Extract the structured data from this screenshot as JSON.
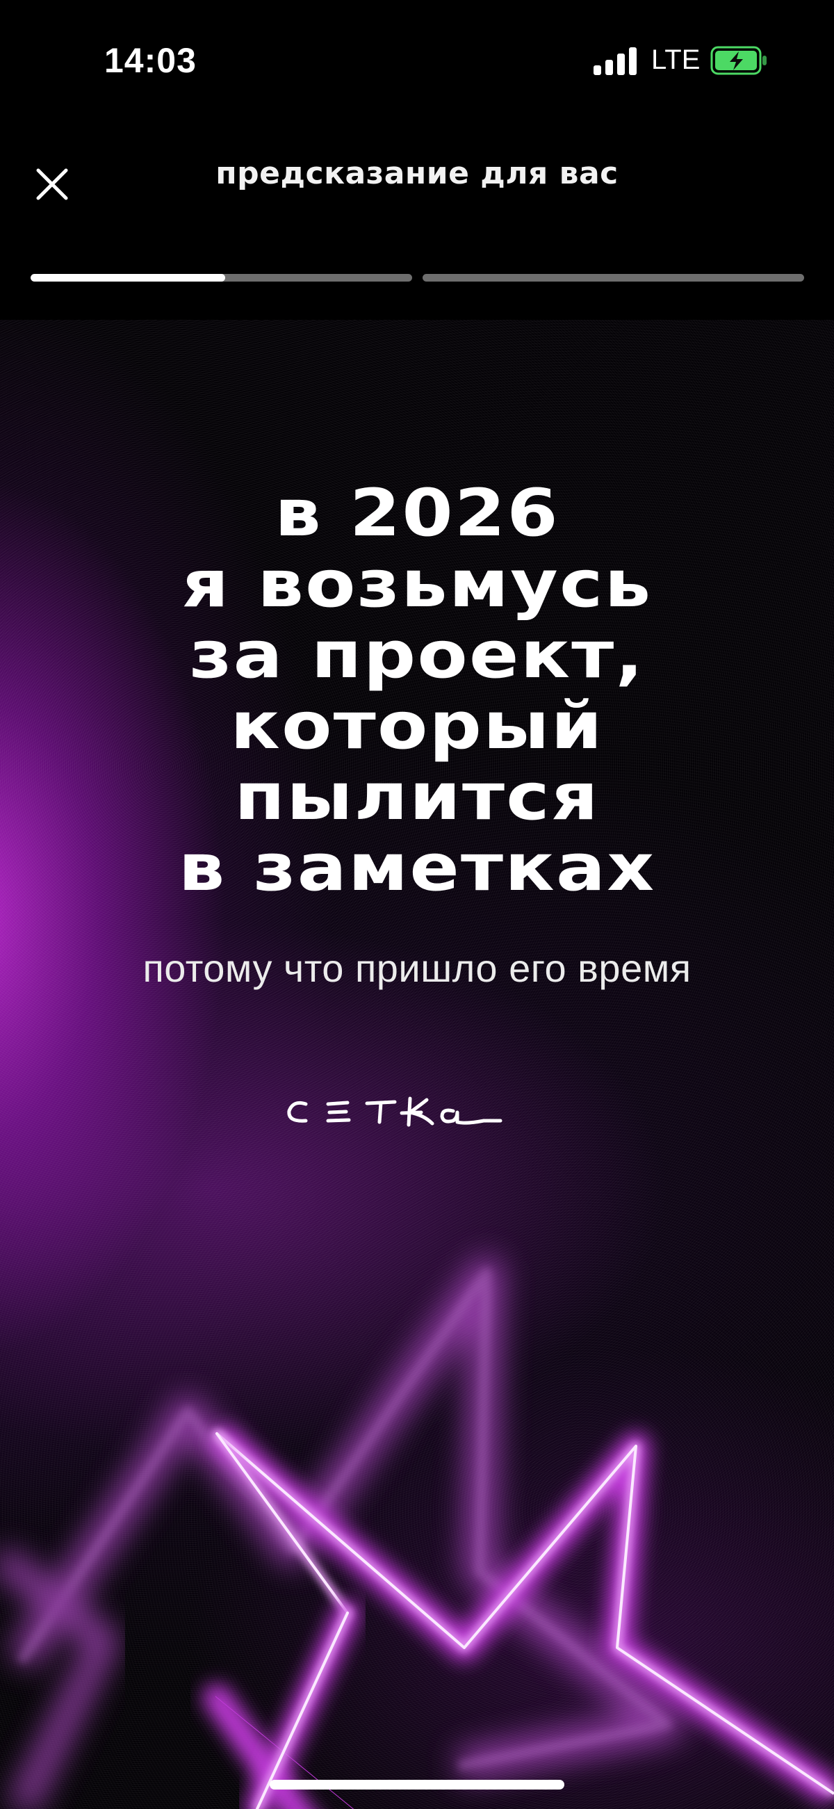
{
  "status_bar": {
    "time": "14:03",
    "network": "LTE",
    "icons": [
      "signal-bars-icon",
      "battery-charging-icon"
    ],
    "battery_color": "#4cd964"
  },
  "header": {
    "title": "предсказание для вас",
    "close_icon": "close-icon",
    "stories": [
      {
        "progress": 0.51
      },
      {
        "progress": 0.0
      }
    ]
  },
  "story": {
    "headline_lines": [
      "в 2026",
      "я возьмусь",
      "за проект,",
      "который",
      "пылится",
      "в заметках"
    ],
    "subline": "потому что пришло его время",
    "logo_text": "СЕТКА",
    "accent_color": "#c43fe0",
    "decoration": "neon-star-icon"
  }
}
